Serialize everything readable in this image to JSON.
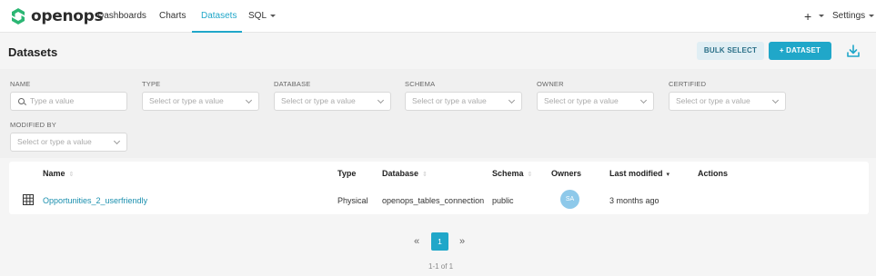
{
  "app": {
    "brand": "openops",
    "accent_color": "#20a7c9"
  },
  "nav": {
    "items": [
      {
        "label": "Dashboards",
        "active": false
      },
      {
        "label": "Charts",
        "active": false
      },
      {
        "label": "Datasets",
        "active": true
      },
      {
        "label": "SQL",
        "active": false
      }
    ],
    "plus": "+",
    "settings": "Settings"
  },
  "page": {
    "title": "Datasets",
    "bulk_select_label": "BULK SELECT",
    "add_dataset_label": "+ DATASET",
    "download_icon": "download-icon"
  },
  "filters": {
    "name": {
      "label": "NAME",
      "placeholder": "Type a value"
    },
    "type": {
      "label": "TYPE",
      "placeholder": "Select or type a value"
    },
    "database": {
      "label": "DATABASE",
      "placeholder": "Select or type a value"
    },
    "schema": {
      "label": "SCHEMA",
      "placeholder": "Select or type a value"
    },
    "owner": {
      "label": "OWNER",
      "placeholder": "Select or type a value"
    },
    "certified": {
      "label": "CERTIFIED",
      "placeholder": "Select or type a value"
    },
    "modified_by": {
      "label": "MODIFIED BY",
      "placeholder": "Select or type a value"
    }
  },
  "table": {
    "columns": {
      "name": "Name",
      "type": "Type",
      "database": "Database",
      "schema": "Schema",
      "owners": "Owners",
      "last_modified": "Last modified",
      "actions": "Actions"
    },
    "rows": [
      {
        "name": "Opportunities_2_userfriendly",
        "type": "Physical",
        "database": "openops_tables_connection",
        "schema": "public",
        "owner_initials": "SA",
        "last_modified": "3 months ago"
      }
    ]
  },
  "pagination": {
    "prev": "«",
    "current": "1",
    "next": "»",
    "info": "1-1 of 1"
  }
}
